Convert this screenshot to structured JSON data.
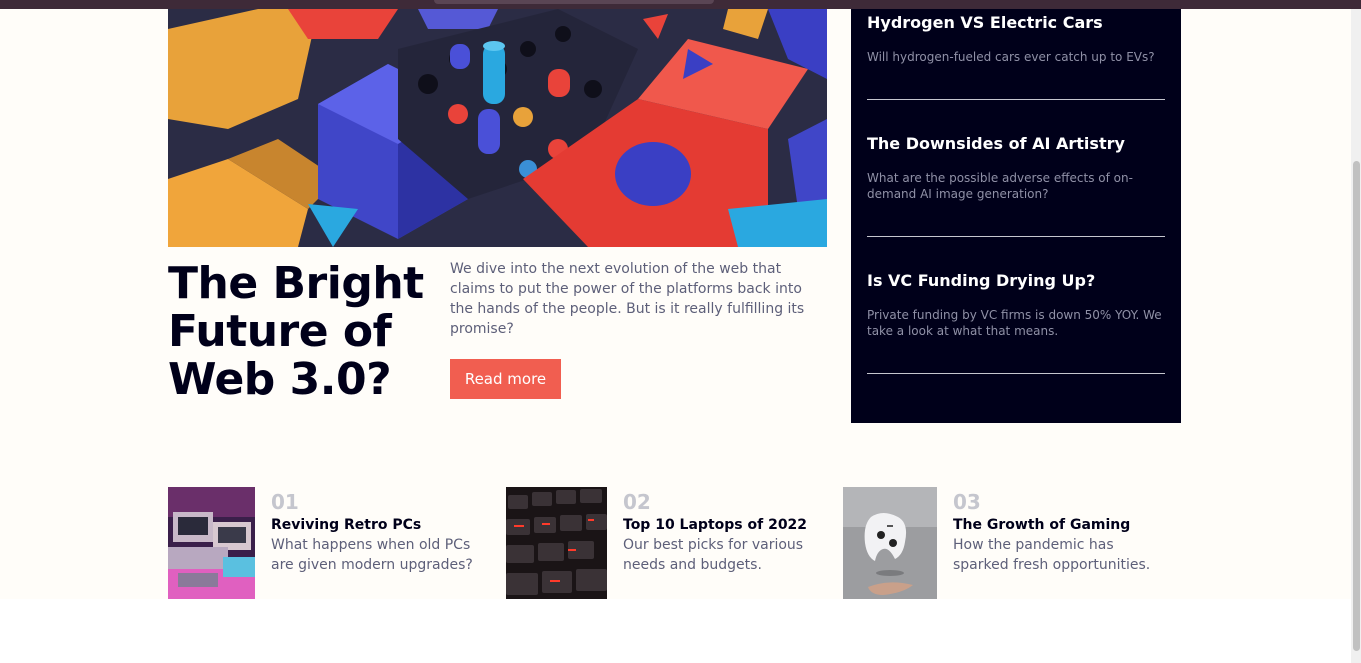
{
  "hero": {
    "title": "The Bright Future of Web 3.0?",
    "description": "We dive into the next evolution of the web that claims to put the power of the platforms back into the hands of the people. But is it really fulfilling its promise?",
    "cta_label": "Read more"
  },
  "sidebar": {
    "items": [
      {
        "title": "Hydrogen VS Electric Cars",
        "description": "Will hydrogen-fueled cars ever catch up to EVs?"
      },
      {
        "title": "The Downsides of AI Artistry",
        "description": "What are the possible adverse effects of on-demand AI image generation?"
      },
      {
        "title": "Is VC Funding Drying Up?",
        "description": "Private funding by VC firms is down 50% YOY. We take a look at what that means."
      }
    ]
  },
  "cards": [
    {
      "number": "01",
      "title": "Reviving Retro PCs",
      "description": "What happens when old PCs are given modern upgrades?",
      "image": "retro-pcs-image"
    },
    {
      "number": "02",
      "title": "Top 10 Laptops of 2022",
      "description": "Our best picks for various needs and budgets.",
      "image": "laptop-keyboard-image"
    },
    {
      "number": "03",
      "title": "The Growth of Gaming",
      "description": "How the pandemic has sparked fresh opportunities.",
      "image": "game-controller-image"
    }
  ],
  "colors": {
    "accent": "#f15e50",
    "sidebar_bg": "#00001a",
    "title": "#00001a",
    "muted": "#5d5f79",
    "number": "#c5c6ce"
  }
}
